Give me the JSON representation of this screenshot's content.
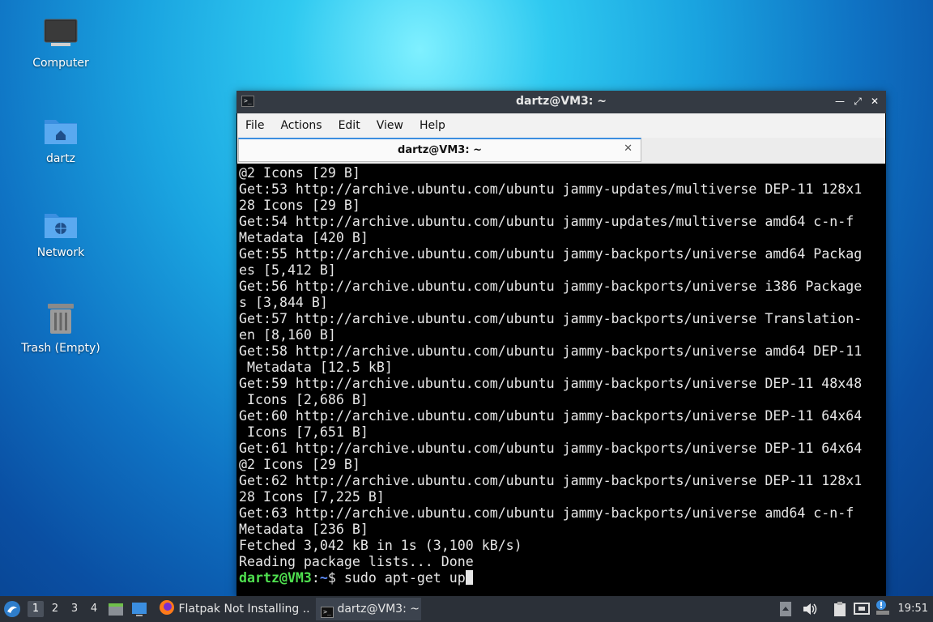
{
  "desktop": {
    "icons": [
      {
        "label": "Computer",
        "icon": "computer-icon"
      },
      {
        "label": "dartz",
        "icon": "home-folder-icon"
      },
      {
        "label": "Network",
        "icon": "network-folder-icon"
      },
      {
        "label": "Trash (Empty)",
        "icon": "trash-icon"
      }
    ]
  },
  "window": {
    "title": "dartz@VM3: ~",
    "controls": [
      "minimize",
      "maximize",
      "close"
    ],
    "menu": [
      "File",
      "Actions",
      "Edit",
      "View",
      "Help"
    ],
    "tab": {
      "label": "dartz@VM3: ~"
    }
  },
  "terminal": {
    "lines": [
      "@2 Icons [29 B]",
      "Get:53 http://archive.ubuntu.com/ubuntu jammy-updates/multiverse DEP-11 128x1",
      "28 Icons [29 B]",
      "Get:54 http://archive.ubuntu.com/ubuntu jammy-updates/multiverse amd64 c-n-f",
      "Metadata [420 B]",
      "Get:55 http://archive.ubuntu.com/ubuntu jammy-backports/universe amd64 Packag",
      "es [5,412 B]",
      "Get:56 http://archive.ubuntu.com/ubuntu jammy-backports/universe i386 Package",
      "s [3,844 B]",
      "Get:57 http://archive.ubuntu.com/ubuntu jammy-backports/universe Translation-",
      "en [8,160 B]",
      "Get:58 http://archive.ubuntu.com/ubuntu jammy-backports/universe amd64 DEP-11",
      " Metadata [12.5 kB]",
      "Get:59 http://archive.ubuntu.com/ubuntu jammy-backports/universe DEP-11 48x48",
      " Icons [2,686 B]",
      "Get:60 http://archive.ubuntu.com/ubuntu jammy-backports/universe DEP-11 64x64",
      " Icons [7,651 B]",
      "Get:61 http://archive.ubuntu.com/ubuntu jammy-backports/universe DEP-11 64x64",
      "@2 Icons [29 B]",
      "Get:62 http://archive.ubuntu.com/ubuntu jammy-backports/universe DEP-11 128x1",
      "28 Icons [7,225 B]",
      "Get:63 http://archive.ubuntu.com/ubuntu jammy-backports/universe amd64 c-n-f",
      "Metadata [236 B]",
      "Fetched 3,042 kB in 1s (3,100 kB/s)",
      "Reading package lists... Done"
    ],
    "prompt": {
      "user_host": "dartz@VM3",
      "sep": ":",
      "path": "~",
      "symbol": "$ ",
      "command": "sudo apt-get up"
    }
  },
  "taskbar": {
    "workspaces": [
      "1",
      "2",
      "3",
      "4"
    ],
    "tasks": [
      {
        "label": "Flatpak Not Installing ...",
        "icon": "firefox-icon"
      },
      {
        "label": "dartz@VM3: ~",
        "icon": "terminal-icon"
      }
    ],
    "clock": "19:51"
  },
  "colors": {
    "prompt_user": "#4fe04f",
    "prompt_path": "#5f8fff",
    "titlebar": "#343a43",
    "taskbar": "#2b3038",
    "tab_accent": "#3b8ee0"
  }
}
